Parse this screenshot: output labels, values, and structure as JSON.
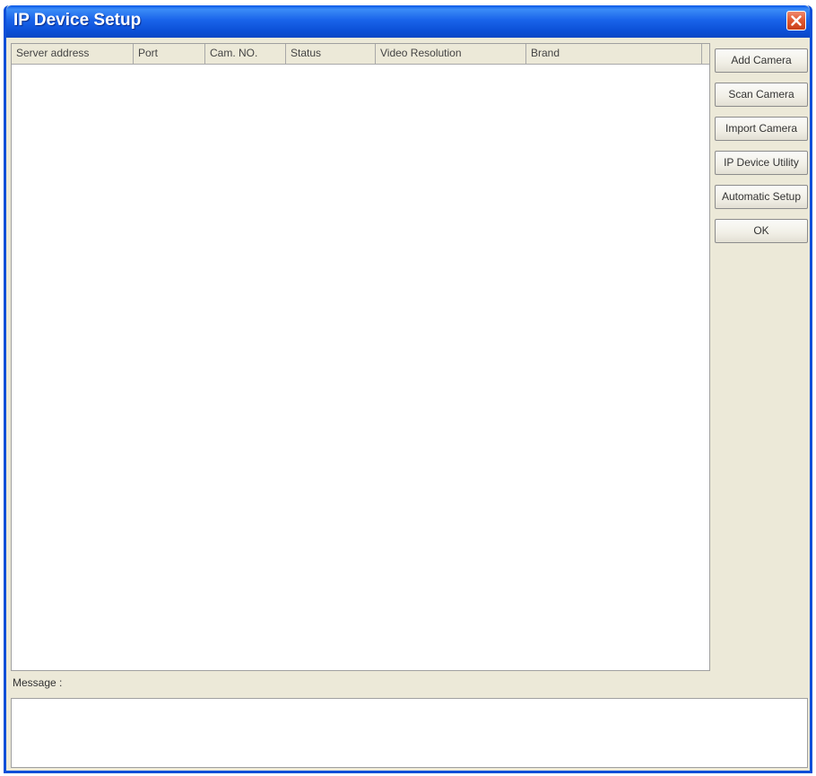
{
  "window": {
    "title": "IP Device Setup"
  },
  "table": {
    "columns": [
      "Server address",
      "Port",
      "Cam. NO.",
      "Status",
      "Video Resolution",
      "Brand"
    ],
    "rows": []
  },
  "buttons": {
    "add_camera": "Add Camera",
    "scan_camera": "Scan Camera",
    "import_camera": "Import Camera",
    "ip_device_utility": "IP Device Utility",
    "automatic_setup": "Automatic Setup",
    "ok": "OK"
  },
  "message": {
    "label": "Message :",
    "text": ""
  },
  "colors": {
    "titlebar": "#0b4fd6",
    "close_button": "#e0582f",
    "window_bg": "#ece9d8"
  },
  "icons": {
    "close": "close-icon"
  }
}
